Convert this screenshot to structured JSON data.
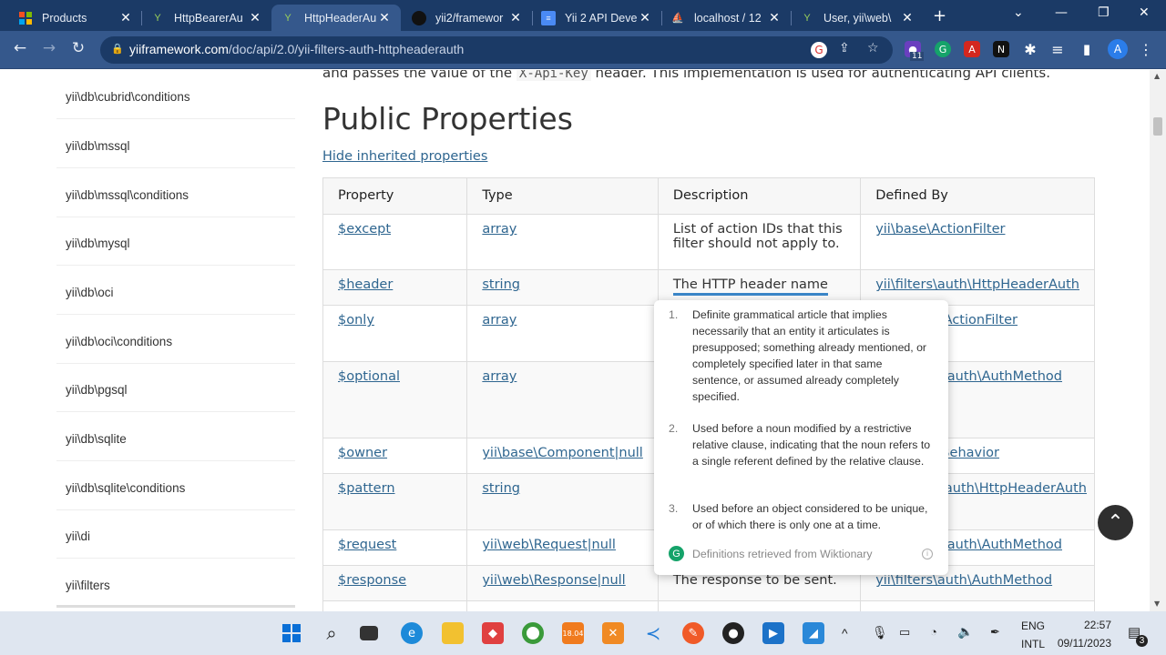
{
  "browser": {
    "tabs": [
      {
        "label": "Products",
        "icon": "windows-grid-icon"
      },
      {
        "label": "HttpBearerAu",
        "icon": "yii-logo-icon"
      },
      {
        "label": "HttpHeaderAu",
        "icon": "yii-logo-icon",
        "active": true
      },
      {
        "label": "yii2/framewor",
        "icon": "github-icon"
      },
      {
        "label": "Yii 2 API Deve",
        "icon": "docs-icon"
      },
      {
        "label": "localhost / 12",
        "icon": "phpmyadmin-icon"
      },
      {
        "label": "User, yii\\web\\",
        "icon": "yii-logo-icon"
      }
    ],
    "new_tab": "+",
    "url_host": "yiiframework.com",
    "url_path": "/doc/api/2.0/yii-filters-auth-httpheaderauth",
    "extension_badge": "11",
    "profile_initial": "A"
  },
  "sidebar": {
    "items": [
      "yii\\db\\cubrid\\conditions",
      "yii\\db\\mssql",
      "yii\\db\\mssql\\conditions",
      "yii\\db\\mysql",
      "yii\\db\\oci",
      "yii\\db\\oci\\conditions",
      "yii\\db\\pgsql",
      "yii\\db\\sqlite",
      "yii\\db\\sqlite\\conditions",
      "yii\\di",
      "yii\\filters"
    ]
  },
  "content": {
    "intro_before": "and passes the value of the",
    "intro_code": "X-Api-Key",
    "intro_after": "header. This implementation is used for authenticating API clients.",
    "heading": "Public Properties",
    "hide_link": "Hide inherited properties",
    "table": {
      "headers": [
        "Property",
        "Type",
        "Description",
        "Defined By"
      ],
      "rows": [
        {
          "property": "$except",
          "type": "array",
          "description": "List of action IDs that this filter should not apply to.",
          "defined_by": "yii\\base\\ActionFilter"
        },
        {
          "property": "$header",
          "type": "string",
          "description": "The HTTP header name",
          "defined_by": "yii\\filters\\auth\\HttpHeaderAuth"
        },
        {
          "property": "$only",
          "type": "array",
          "description": "",
          "defined_by": "ActionFilter"
        },
        {
          "property": "$optional",
          "type": "array",
          "description": "",
          "defined_by": "auth\\AuthMethod"
        },
        {
          "property": "$owner",
          "type": "yii\\base\\Component|null",
          "description": "",
          "defined_by": "Behavior"
        },
        {
          "property": "$pattern",
          "type": "string",
          "description": "",
          "defined_by": "auth\\HttpHeaderAuth"
        },
        {
          "property": "$request",
          "type": "yii\\web\\Request|null",
          "description": "",
          "defined_by": "auth\\AuthMethod"
        },
        {
          "property": "$response",
          "type": "yii\\web\\Response|null",
          "description": "The response to be sent.",
          "defined_by": "yii\\filters\\auth\\AuthMethod"
        }
      ]
    }
  },
  "popup": {
    "definitions": [
      {
        "num": "1.",
        "text": "Definite grammatical article that implies necessarily that an entity it articulates is presupposed; something already mentioned, or completely specified later in that same sentence, or assumed already completely specified."
      },
      {
        "num": "2.",
        "text": "Used before a noun modified by a restrictive relative clause, indicating that the noun refers to a single referent defined by the relative clause."
      },
      {
        "num": "3.",
        "text": "Used before an object considered to be unique, or of which there is only one at a time."
      }
    ],
    "footer": "Definitions retrieved from Wiktionary"
  },
  "taskbar": {
    "lang_top": "ENG",
    "lang_bottom": "INTL",
    "time": "22:57",
    "date": "09/11/2023",
    "notification_count": "3"
  }
}
